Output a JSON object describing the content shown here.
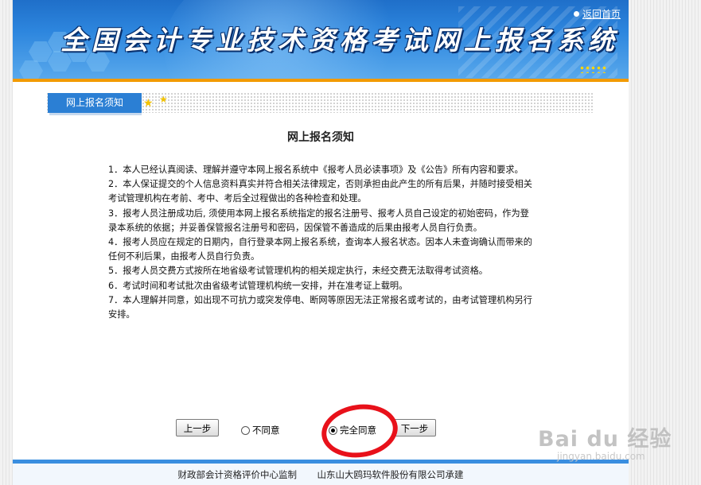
{
  "header": {
    "site_title": "全国会计专业技术资格考试网上报名系统",
    "home_link": "返回首页"
  },
  "tab": {
    "label": "网上报名须知"
  },
  "notice": {
    "title": "网上报名须知",
    "items": [
      "1．本人已经认真阅读、理解并遵守本网上报名系统中《报考人员必读事项》及《公告》所有内容和要求。",
      "2．本人保证提交的个人信息资料真实并符合相关法律规定，否则承担由此产生的所有后果，并随时接受相关考试管理机构在考前、考中、考后全过程做出的各种检查和处理。",
      "3．报考人员注册成功后, 须使用本网上报名系统指定的报名注册号、报考人员自己设定的初始密码，作为登录本系统的依据；并妥善保管报名注册号和密码，因保管不善造成的后果由报考人员自行负责。",
      "4．报考人员应在规定的日期内，自行登录本网上报名系统，查询本人报名状态。因本人未查询确认而带来的任何不利后果，由报考人员自行负责。",
      "5．报考人员交费方式按所在地省级考试管理机构的相关规定执行，未经交费无法取得考试资格。",
      "6．考试时间和考试批次由省级考试管理机构统一安排，并在准考证上载明。",
      "7．本人理解并同意，如出现不可抗力或突发停电、断网等原因无法正常报名或考试的，由考试管理机构另行安排。"
    ]
  },
  "controls": {
    "prev_label": "上一步",
    "disagree_label": "不同意",
    "agree_label": "完全同意",
    "next_label": "下一步",
    "selected": "agree"
  },
  "footer": {
    "supervisor": "财政部会计资格评价中心监制",
    "builder": "山东山大鸥玛软件股份有限公司承建"
  },
  "watermark": {
    "logo": "Bai du 经验",
    "url": "jingyan.baidu.com"
  },
  "colors": {
    "header_blue": "#2d86de",
    "accent_orange": "#f29a00",
    "tab_blue": "#2b7fd4",
    "annotation_red": "#e8111a"
  }
}
